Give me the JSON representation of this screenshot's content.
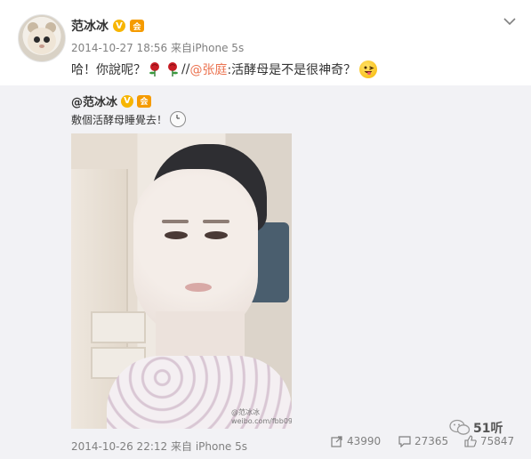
{
  "post": {
    "user_name": "范冰冰",
    "verified_badge": "V",
    "member_badge": "会",
    "timestamp": "2014-10-27 18:56",
    "source_prefix": "来自",
    "source": "iPhone 5s",
    "text_before": "哈！你說呢？",
    "rose_icon": "rose-icon",
    "text_sep": " //",
    "mention": "@张庭",
    "text_after": ":活酵母是不是很神奇？",
    "emoji_icon": "naughty-face-emoji-icon"
  },
  "repost": {
    "user_name": "@范冰冰",
    "verified_badge": "V",
    "member_badge": "会",
    "text": "敷個活酵母睡覺去！",
    "clock_icon": "clock-icon",
    "timestamp": "2014-10-26 22:12",
    "source_prefix": "来自",
    "source": "iPhone 5s",
    "watermark": "@范冰冰 weibo.com/fbb0916",
    "actions": {
      "forward_count": "43990",
      "comment_count": "27365",
      "like_count": "75847"
    }
  },
  "overlay_logo": {
    "text": "51听",
    "icon": "wechat-icon"
  },
  "colors": {
    "accent_mention": "#eb7350",
    "meta_gray": "#808080",
    "repost_bg": "#f2f2f5",
    "verified_gold": "#f7b500"
  }
}
